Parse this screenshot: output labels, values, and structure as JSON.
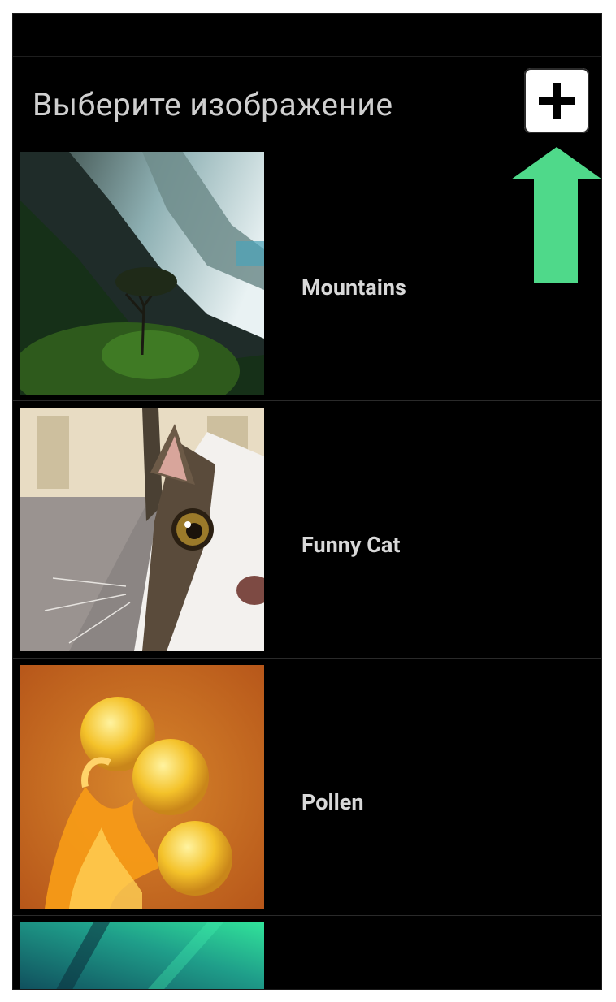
{
  "header": {
    "title": "Выберите изображение",
    "add_button": "plus-icon"
  },
  "images": [
    {
      "label": "Mountains"
    },
    {
      "label": "Funny Cat"
    },
    {
      "label": "Pollen"
    },
    {
      "label": ""
    }
  ],
  "colors": {
    "background": "#000000",
    "arrow": "#4fd98a",
    "button": "#ffffff"
  }
}
